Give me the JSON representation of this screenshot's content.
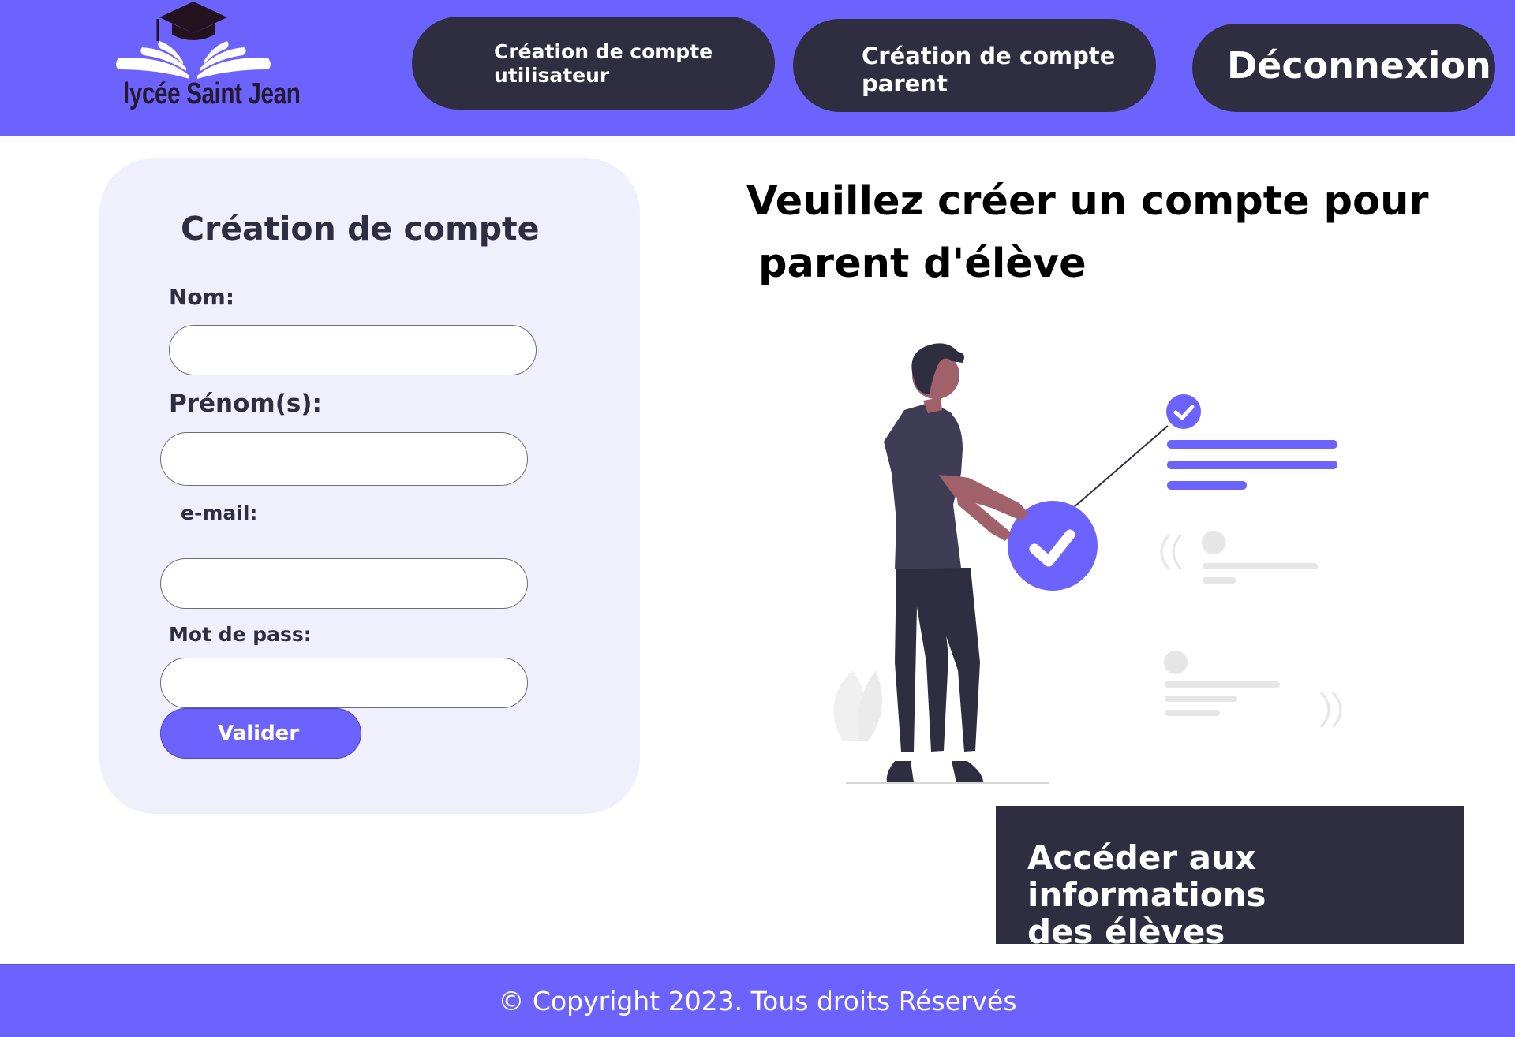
{
  "header": {
    "logo_text": "lycée Saint Jean",
    "nav": {
      "create_user": "Création de compte\nutilisateur",
      "create_parent": "Création de compte\nparent",
      "logout": "Déconnexion"
    }
  },
  "form": {
    "title": "Création de compte",
    "fields": {
      "nom": {
        "label": "Nom:",
        "value": ""
      },
      "prenom": {
        "label": "Prénom(s):",
        "value": ""
      },
      "email": {
        "label": "e-mail:",
        "value": ""
      },
      "password": {
        "label": "Mot de pass:",
        "value": ""
      }
    },
    "submit_label": "Valider"
  },
  "headline": {
    "line1": "Veuillez créer un compte pour",
    "line2": "parent d'élève"
  },
  "access_button": "Accéder aux informations\ndes élèves",
  "footer": {
    "copyright": "© Copyright 2023. Tous droits Réservés"
  },
  "colors": {
    "accent": "#6c63ff",
    "dark": "#2f2e41",
    "card_bg": "#f0effc",
    "skin": "#a0616a"
  },
  "icons": [
    "graduation-cap-icon",
    "open-book-icon",
    "check-circle-icon"
  ]
}
